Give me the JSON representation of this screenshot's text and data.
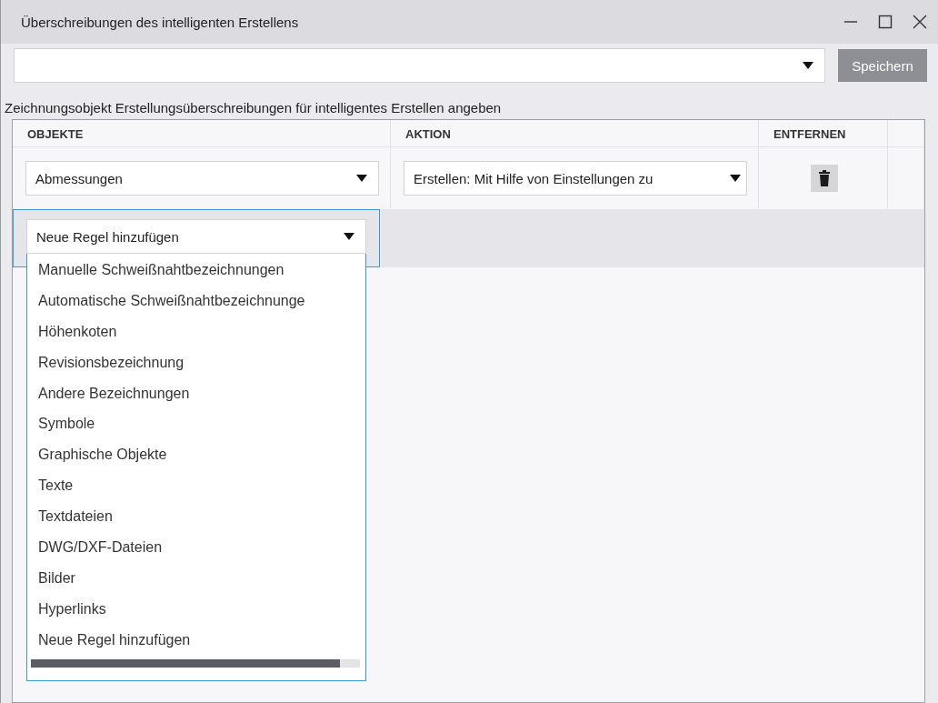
{
  "window": {
    "title": "Überschreibungen des intelligenten Erstellens"
  },
  "toolbar": {
    "save_button": {
      "label": "Speichern",
      "disabled": true
    }
  },
  "caption": "Zeichnungsobjekt Erstellungsüberschreibungen für intelligentes Erstellen angeben",
  "table": {
    "columns": [
      "OBJEKTE",
      "AKTION",
      "ENTFERNEN"
    ],
    "rows": [
      {
        "object": "Abmessungen",
        "action": "Erstellen: Mit Hilfe von Einstellungen zu"
      }
    ],
    "new_rule": {
      "value": "Neue Regel hinzufügen",
      "expanded": true,
      "options": [
        {
          "label": "Manuelle Schweißnahtbezeichnungen"
        },
        {
          "label": "Automatische Schweißnahtbezeichnunge"
        },
        {
          "label": "Höhenkoten"
        },
        {
          "label": "Revisionsbezeichnung"
        },
        {
          "label": "Andere Bezeichnungen"
        },
        {
          "label": "Symbole"
        },
        {
          "label": "Graphische Objekte"
        },
        {
          "label": "Texte"
        },
        {
          "label": "Textdateien"
        },
        {
          "label": "DWG/DXF-Dateien"
        },
        {
          "label": "Bilder"
        },
        {
          "label": "Hyperlinks"
        },
        {
          "label": "Neue Regel hinzufügen"
        }
      ]
    }
  }
}
